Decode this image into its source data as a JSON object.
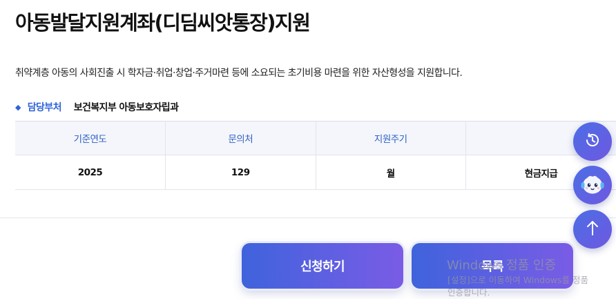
{
  "page": {
    "title": "아동발달지원계좌(디딤씨앗통장)지원",
    "description": "취약계층 아동의 사회진출 시 학자금·취업·창업·주거마련 등에 소요되는 초기비용 마련을 위한 자산형성을 지원합니다."
  },
  "department": {
    "label": "담당부처",
    "value": "보건복지부 아동보호자립과"
  },
  "table": {
    "headers": [
      "기준연도",
      "문의처",
      "지원주기",
      ""
    ],
    "row": [
      "2025",
      "129",
      "월",
      "현금지급"
    ]
  },
  "buttons": {
    "apply": "신청하기",
    "list": "목록"
  },
  "floating": {
    "history_icon": "history-icon",
    "chatbot_icon": "chatbot-icon",
    "top_icon": "arrow-up-icon"
  },
  "watermark": {
    "title": "Windows 정품 인증",
    "line1": "[설정]으로 이동하여 Windows를 정품",
    "line2": "인증합니다."
  },
  "colors": {
    "accent": "#2f63d8",
    "button_start": "#3f63dc",
    "button_end": "#7a5ce6"
  }
}
